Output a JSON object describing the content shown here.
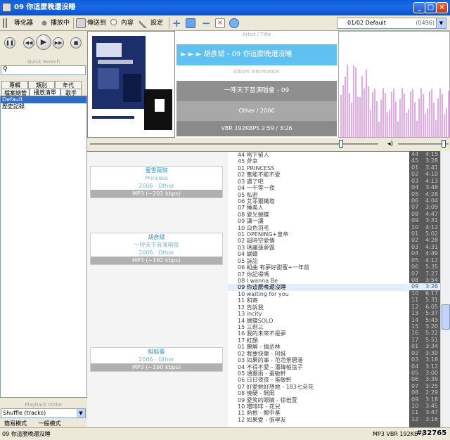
{
  "window": {
    "title": "09 你這麼晚還沒睡"
  },
  "toolbar": {
    "equalizer": "等化器",
    "now_playing": "播放中",
    "send_to": "傳送到",
    "content": "內容",
    "settings": "設定"
  },
  "playlist_selector": {
    "value": "01/02 Default",
    "count": "(0496)"
  },
  "left_panel": {
    "quick_search_label": "Quick Search",
    "quick_search_value": "",
    "tabs_row1": [
      "專輯",
      "類別",
      "年代"
    ],
    "tabs_row2": [
      "檔案總管",
      "播放清單",
      "歌手"
    ],
    "tree": [
      "Default",
      "歷史記錄"
    ],
    "playback_order_label": "Playback Order",
    "playback_order_value": "Shuffle (tracks)",
    "mode_simple": "簡易模式",
    "mode_normal": "一般模式"
  },
  "now_playing_info": {
    "artist_title_label": "Artist / Title",
    "artist_title": "► ► ►  胡彥斌 - 09 你這麼晚還沒睡",
    "album_info_label": "Album Information",
    "album": "一呼天下音演唱會 - 09",
    "genre_year": "Other / 2006",
    "tech": "VBR 192KBPS   2:59 / 3:26"
  },
  "seek": {
    "position": 0.87
  },
  "volume": {
    "level": 0.9
  },
  "groups": [
    {
      "artist": "蜜雪薇琪",
      "sub": "Princess",
      "meta": "2006 · Other",
      "tech": "MP3 (~201 kbps)"
    },
    {
      "artist": "胡彥斌",
      "sub": "一呼天下音演唱會",
      "meta": "2006 · Other",
      "tech": "MP3 (~192 kbps)"
    },
    {
      "artist": "鮭鮭萎",
      "sub": "",
      "meta": "2006 · Other",
      "tech": "MP3 (~190 kbps)"
    }
  ],
  "tracks": [
    "44 吻下留人",
    "45 斧幸",
    "01 PRINCESS",
    "02 奮能不能不愛",
    "03 遇了吧",
    "04 一千零一夜",
    "05 私密",
    "06 艾菲爾鐵塔",
    "07 睡美人",
    "08 愛光蝴蝶",
    "09 讓一讓",
    "10 白色羽毛",
    "01 OPENING+皇帝",
    "02 超時空愛情",
    "03 瑪麗蓮夢露",
    "04 蝴蝶",
    "05 訴訟",
    "06 組曲 有夢好甜蜜+一年前",
    "07 你記得嗎",
    "08 I wanna Be",
    "09 你這麼晚還沒睡",
    "10 waiting for you",
    "11 和寄",
    "12 告訴我",
    "13 incity",
    "14 蝴蝶SOLO",
    "15 三劍三",
    "16 我的未來不是夢",
    "17 紅顏",
    "01 瞭解 - 搞丞林",
    "02 我要快樂 - 阿妹",
    "03 如果的事 - 范范景碧涵",
    "04 不得不愛 - 潘瑋柏弦子",
    "05 通靈雨 - 蛋敏軒",
    "06 日日夜夜 - 蛋敏軒",
    "07 好愛她好想她 - 183七朵花",
    "08 僥硬 - 飼田",
    "09 愛笑的眼睛 - 徐若萱",
    "10 噹啡啡 - 花兒",
    "11 熱根 - 鄭中基",
    "12 如果愛 - 張學友"
  ],
  "times": [
    [
      "44",
      "4:15"
    ],
    [
      "45",
      "3:28"
    ],
    [
      "01",
      "3:41"
    ],
    [
      "02",
      "4:10"
    ],
    [
      "03",
      "4:13"
    ],
    [
      "04",
      "3:48"
    ],
    [
      "05",
      "4:28"
    ],
    [
      "06",
      "4:04"
    ],
    [
      "07",
      "3:09"
    ],
    [
      "08",
      "4:47"
    ],
    [
      "09",
      "3:31"
    ],
    [
      "10",
      "4:12"
    ],
    [
      "01",
      "5:02"
    ],
    [
      "02",
      "4:28"
    ],
    [
      "03",
      "4:31"
    ],
    [
      "04",
      "4:49"
    ],
    [
      "05",
      "4:12"
    ],
    [
      "06",
      "5:35"
    ],
    [
      "07",
      "7:27"
    ],
    [
      "08",
      "3:54"
    ],
    [
      "09",
      "3:26"
    ],
    [
      "10",
      "6:17"
    ],
    [
      "11",
      "5:31"
    ],
    [
      "12",
      "6:05"
    ],
    [
      "13",
      "5:37"
    ],
    [
      "14",
      "5:43"
    ],
    [
      "15",
      "3:20"
    ],
    [
      "16",
      "5:22"
    ],
    [
      "17",
      "5:51"
    ],
    [
      "01",
      "3:34"
    ],
    [
      "02",
      "3:30"
    ],
    [
      "03",
      "3:18"
    ],
    [
      "04",
      "3:12"
    ],
    [
      "05",
      "3:00"
    ],
    [
      "06",
      "3:39"
    ],
    [
      "07",
      "3:25"
    ],
    [
      "08",
      "2:29"
    ],
    [
      "09",
      "3:18"
    ],
    [
      "10",
      "3:45"
    ],
    [
      "11",
      "3:47"
    ],
    [
      "12",
      "3:16"
    ]
  ],
  "current_track_index": 20,
  "status": {
    "left": "09 你這麼晚還沒睡",
    "right": "MP3 VBR 192KBPS"
  },
  "watermark": "#32765",
  "colors": {
    "accent_blue": "#5fc1f1",
    "viz_pink": "#e6a8ea",
    "title_blue": "#0a5fd8"
  }
}
